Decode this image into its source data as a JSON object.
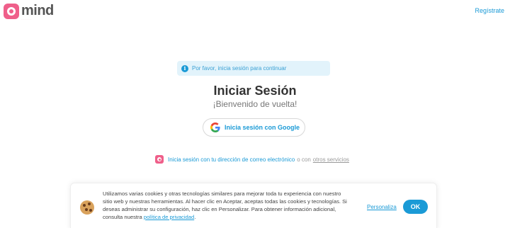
{
  "brand": {
    "name": "mind",
    "tagline": "··········"
  },
  "header": {
    "register_label": "Regístrate"
  },
  "alert": {
    "icon": "info-icon",
    "text": "Por favor, inicia sesión para continuar"
  },
  "login": {
    "title": "Iniciar Sesión",
    "subtitle": "¡Bienvenido de vuelta!",
    "google_button_label": "Inicia sesión con Google",
    "email_link_label": "Inicia sesión con tu dirección de correo electrónico",
    "or_text": "o con",
    "other_services_label": "otros servicios"
  },
  "cookie_banner": {
    "icon": "cookie-icon",
    "text": "Utilizamos varias cookies y otras tecnologías similares para mejorar toda tu experiencia con nuestro sitio web y nuestras herramientas. Al hacer clic en Aceptar, aceptas todas las cookies y tecnologías. Si deseas administrar su configuración, haz clic en Personalizar. Para obtener información adicional, consulta nuestra",
    "privacy_link_label": "política de privacidad",
    "text_end": ".",
    "personalize_label": "Personaliza",
    "ok_label": "OK"
  },
  "colors": {
    "accent": "#1a9ad6",
    "brand": "#ef5f8a",
    "alert_bg": "#e2f3fb"
  }
}
